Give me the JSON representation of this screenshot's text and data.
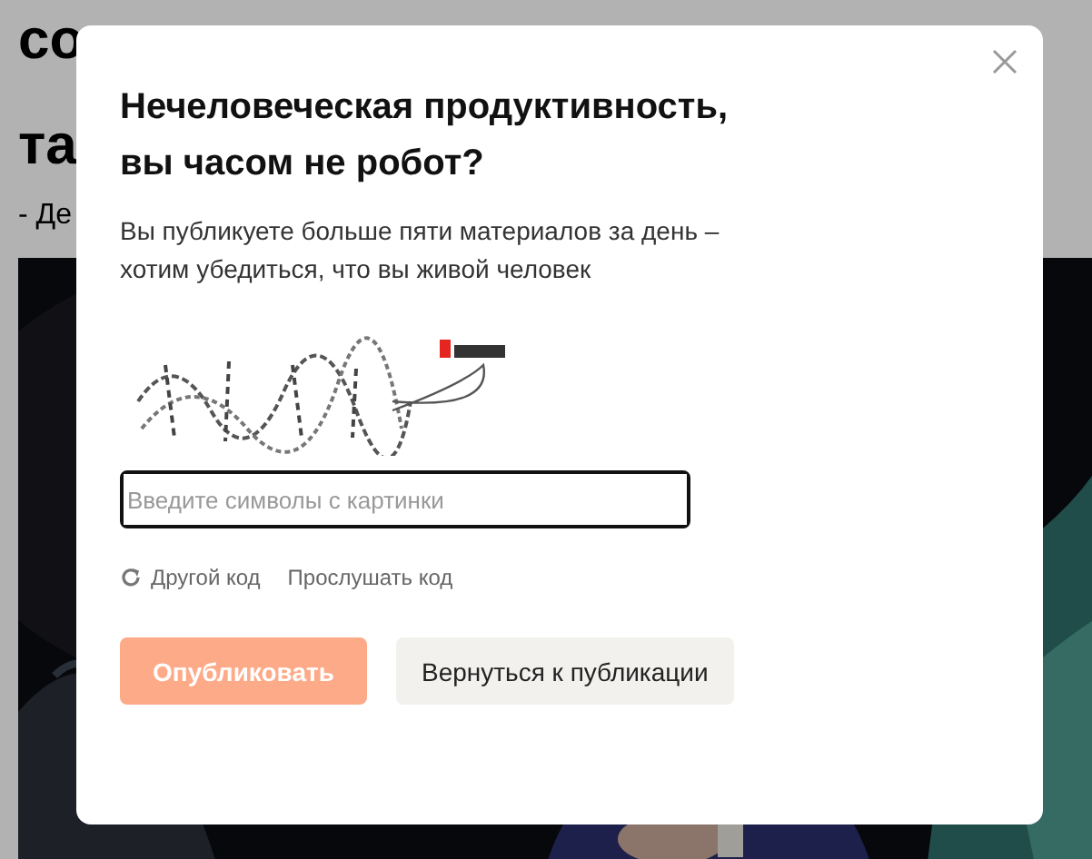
{
  "article": {
    "headline_lines": [
      "со",
      "та"
    ],
    "byline": "- Де"
  },
  "dialog": {
    "title": "Нечеловеческая продуктивность, вы часом не робот?",
    "message": "Вы публикуете больше пяти материалов за день – хотим убедиться, что вы живой человек",
    "input": {
      "placeholder": "Введите символы с картинки"
    },
    "links": [
      {
        "label": "Другой код",
        "kind": "refresh"
      },
      {
        "label": "Прослушать код",
        "kind": "plain"
      }
    ],
    "buttons": [
      {
        "label": "Опубликовать",
        "kind": "primary",
        "disabled": true
      },
      {
        "label": "Вернуться к публикации",
        "kind": "secondary",
        "disabled": false
      }
    ]
  }
}
